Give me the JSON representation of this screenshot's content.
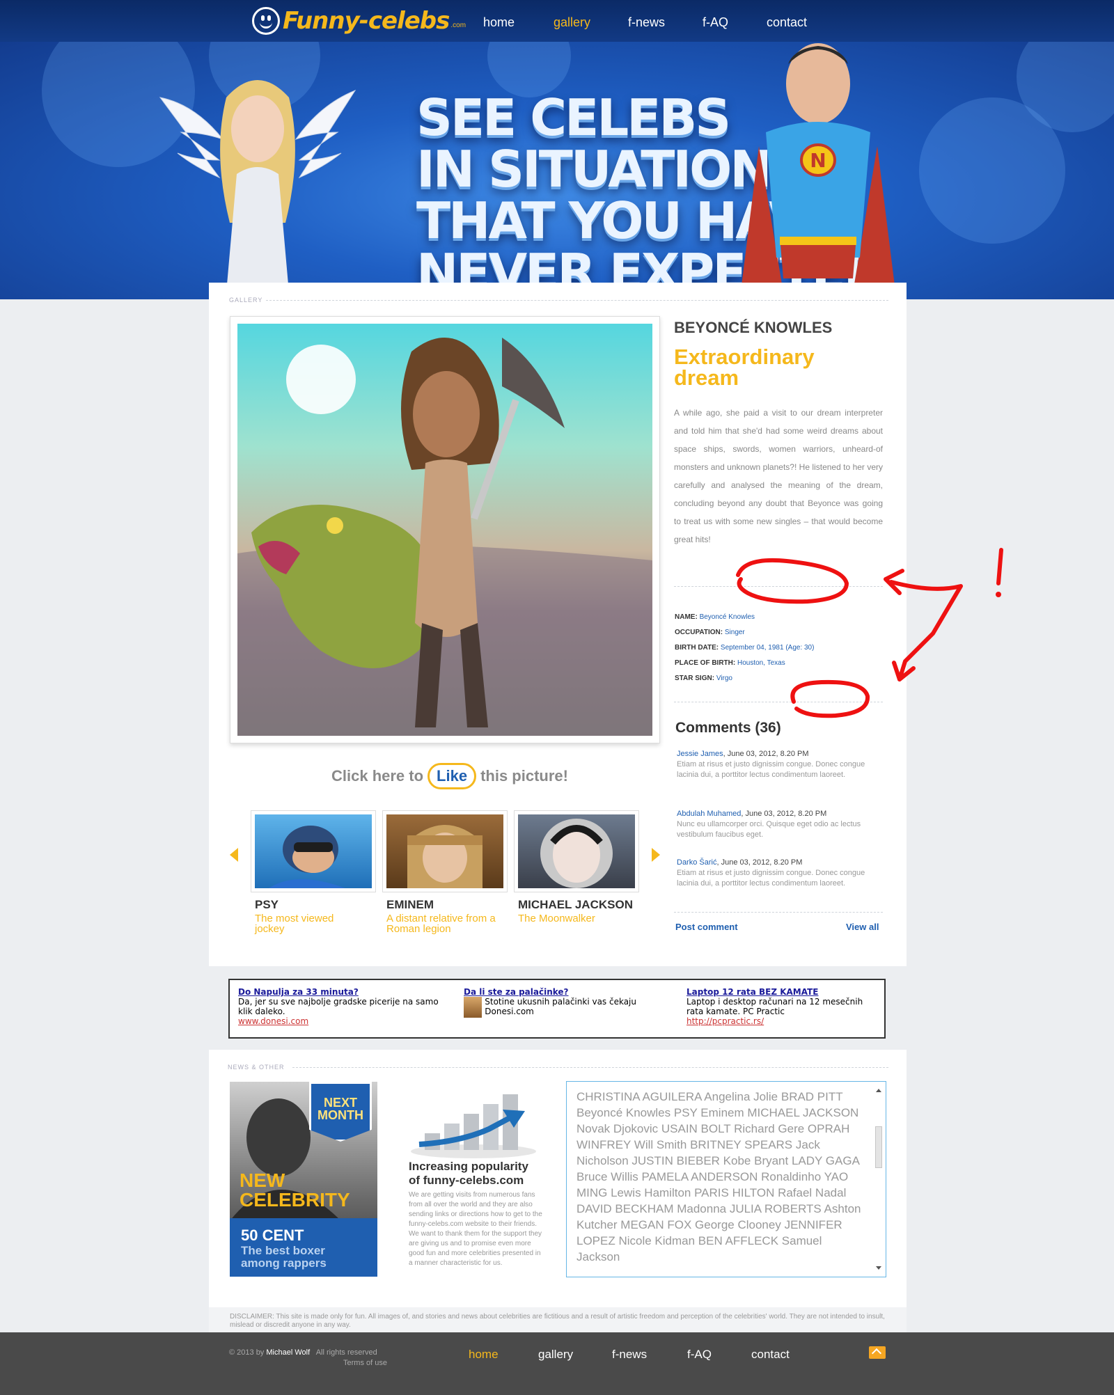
{
  "header": {
    "logo_text": "Funny-celebs",
    "logo_suffix": ".com",
    "nav": [
      {
        "label": "home",
        "active": false
      },
      {
        "label": "gallery",
        "active": true
      },
      {
        "label": "f-news",
        "active": false
      },
      {
        "label": "f-AQ",
        "active": false
      },
      {
        "label": "contact",
        "active": false
      }
    ]
  },
  "hero": {
    "lines": [
      "SEE CELEBS",
      "IN SITUATIONS",
      "THAT YOU HAVE",
      "NEVER EXPECTED"
    ]
  },
  "gallery": {
    "section_label": "GALLERY",
    "celeb_name": "BEYONCÉ KNOWLES",
    "title_line1": "Extraordinary",
    "title_line2": "dream",
    "description": "A while ago, she paid a visit to our dream interpreter and told him that she'd had some weird dreams about space ships, swords, women warriors, unheard-of monsters and unknown planets?! He listened to her very carefully and analysed the meaning of the dream, concluding beyond any doubt that Beyonce was going to treat us with some new singles – that would become great hits!",
    "info": [
      {
        "key": "NAME:",
        "value": "Beyoncé Knowles"
      },
      {
        "key": "OCCUPATION:",
        "value": "Singer"
      },
      {
        "key": "BIRTH DATE:",
        "value": "September 04, 1981 (Age: 30)"
      },
      {
        "key": "PLACE OF BIRTH:",
        "value": "Houston, Texas"
      },
      {
        "key": "STAR SIGN:",
        "value": "Virgo"
      }
    ],
    "like": {
      "prefix": "Click here to",
      "button": "Like",
      "suffix": "this picture!"
    },
    "thumbs": [
      {
        "name": "PSY",
        "sub": "The most viewed jockey"
      },
      {
        "name": "EMINEM",
        "sub": "A distant relative from a Roman legion"
      },
      {
        "name": "MICHAEL JACKSON",
        "sub": "The Moonwalker"
      }
    ]
  },
  "comments": {
    "title": "Comments (36)",
    "items": [
      {
        "author": "Jessie James",
        "meta": ", June 03, 2012, 8.20 PM",
        "text": "Etiam at risus et justo dignissim congue. Donec congue lacinia dui, a porttitor lectus condimentum laoreet."
      },
      {
        "author": "Abdulah Muhamed",
        "meta": ", June 03, 2012, 8.20 PM",
        "text": "Nunc eu ullamcorper orci. Quisque eget odio ac lectus vestibulum faucibus eget."
      },
      {
        "author": "Darko Šarić",
        "meta": ", June 03, 2012, 8.20 PM",
        "text": "Etiam at risus et justo dignissim congue. Donec congue lacinia dui, a porttitor lectus condimentum laoreet."
      }
    ],
    "post_label": "Post comment",
    "view_all_label": "View all"
  },
  "ads": [
    {
      "title": "Do Napulja za 33 minuta?",
      "text": "Da, jer su sve najbolje gradske picerije na samo klik daleko.",
      "link": "www.donesi.com"
    },
    {
      "title": "Da li ste za palačinke?",
      "text": "Stotine ukusnih palačinki vas čekaju Donesi.com",
      "link": ""
    },
    {
      "title": "Laptop 12 rata BEZ KAMATE",
      "text": "Laptop i desktop računari na 12 mesečnih rata kamate. PC Practic",
      "link": "http://pcpractic.rs/"
    }
  ],
  "news": {
    "section_label": "NEWS & OTHER",
    "promo": {
      "badge_line1": "NEXT",
      "badge_line2": "MONTH",
      "new_line1": "NEW",
      "new_line2": "CELEBRITY",
      "name": "50 CENT",
      "sub_line1": "The best boxer",
      "sub_line2": "among rappers"
    },
    "popularity_title_line1": "Increasing popularity",
    "popularity_title_line2": "of funny-celebs.com",
    "popularity_text": "We are getting visits from numerous fans from all over the world and they are also sending links or directions how to get to the funny-celebs.com website to their friends. We want to thank them for the support they are giving us and to promise even more good fun and more celebrities presented in a manner characteristic for us.",
    "tags_text": "CHRISTINA AGUILERA Angelina Jolie BRAD PITT Beyoncé Knowles PSY Eminem MICHAEL JACKSON Novak Djokovic USAIN BOLT Richard Gere OPRAH WINFREY Will Smith BRITNEY SPEARS Jack Nicholson JUSTIN BIEBER Kobe Bryant LADY GAGA Bruce Willis PAMELA ANDERSON Ronaldinho YAO MING Lewis Hamilton PARIS HILTON Rafael Nadal  DAVID BECKHAM Madonna JULIA ROBERTS Ashton Kutcher MEGAN FOX George Clooney JENNIFER LOPEZ Nicole Kidman BEN AFFLECK Samuel Jackson"
  },
  "disclaimer": "DISCLAIMER: This site is made only for fun. All images of, and stories and news about celebrities are fictitious and a result of artistic freedom and perception of the celebrities' world. They are not intended to insult, mislead or discredit anyone in any way.",
  "footer": {
    "copy_prefix": "© 2013 by",
    "author": "Michael Wolf",
    "rights": "All rights reserved",
    "terms": "Terms of use",
    "nav": [
      {
        "label": "home",
        "active": true
      },
      {
        "label": "gallery",
        "active": false
      },
      {
        "label": "f-news",
        "active": false
      },
      {
        "label": "f-AQ",
        "active": false
      },
      {
        "label": "contact",
        "active": false
      }
    ]
  },
  "colors": {
    "accent": "#f5b81c",
    "link": "#1f5fb0",
    "header": "#0b2a66",
    "annotation": "#ee1111"
  }
}
